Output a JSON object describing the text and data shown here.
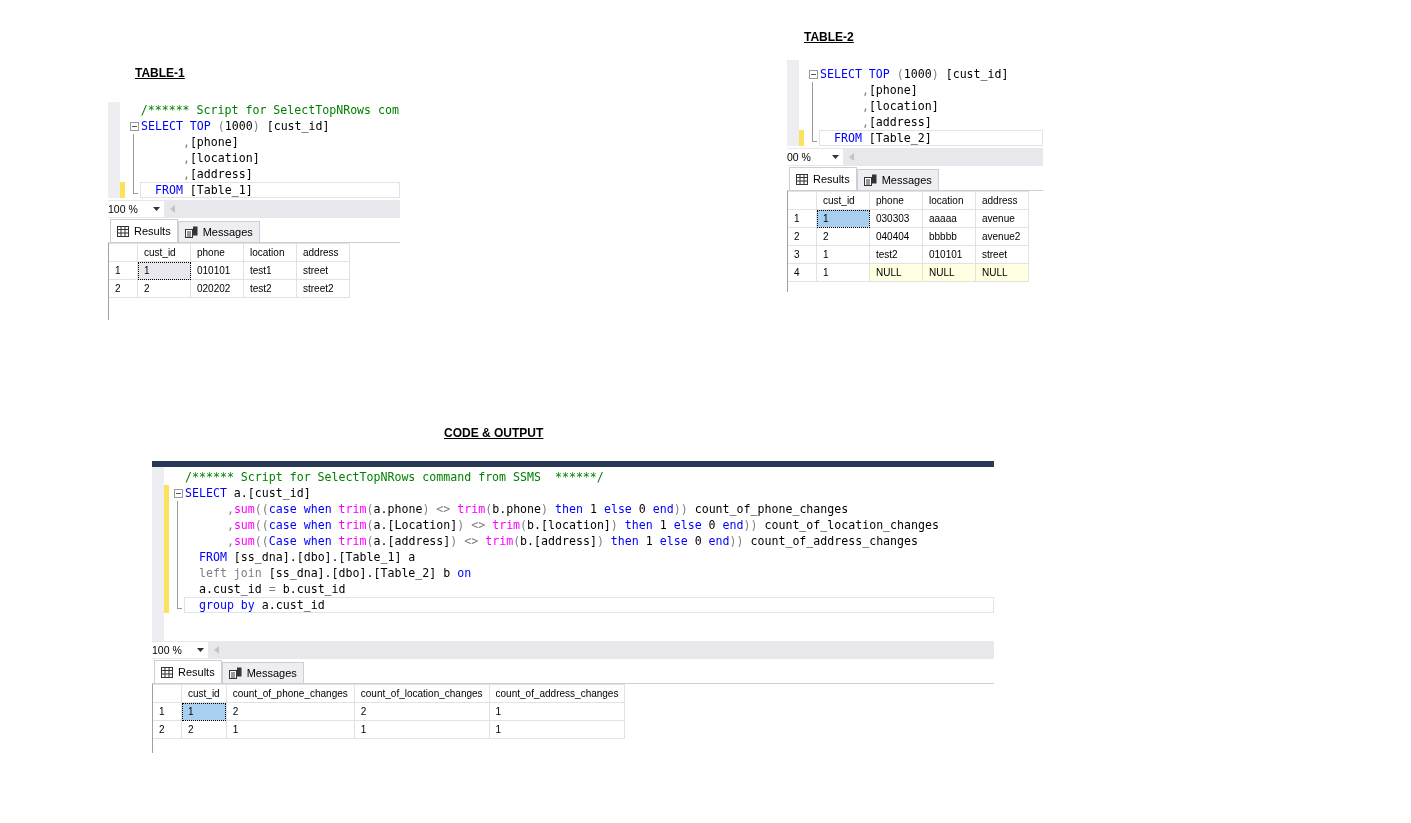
{
  "panels": [
    {
      "heading": "TABLE-1",
      "editor": {
        "tab_bar": false,
        "lines": [
          {
            "kind": "plain",
            "changed": false,
            "current": false,
            "tokens": [
              {
                "t": "/****** Script for SelectTopNRows com",
                "kind": "comment"
              }
            ]
          },
          {
            "kind": "fold_start",
            "changed": false,
            "current": false,
            "tokens": [
              {
                "t": "SELECT",
                "kind": "keyword"
              },
              {
                "t": " TOP",
                "kind": "keyword"
              },
              {
                "t": " (",
                "kind": "gray"
              },
              {
                "t": "1000",
                "kind": "plain"
              },
              {
                "t": ")",
                "kind": "gray"
              },
              {
                "t": " [cust_id]",
                "kind": "plain"
              }
            ]
          },
          {
            "kind": "fold_line",
            "changed": false,
            "current": false,
            "tokens": [
              {
                "t": "      ,",
                "kind": "gray"
              },
              {
                "t": "[phone]",
                "kind": "plain"
              }
            ]
          },
          {
            "kind": "fold_line",
            "changed": false,
            "current": false,
            "tokens": [
              {
                "t": "      ,",
                "kind": "gray"
              },
              {
                "t": "[location]",
                "kind": "plain"
              }
            ]
          },
          {
            "kind": "fold_line",
            "changed": false,
            "current": false,
            "tokens": [
              {
                "t": "      ,",
                "kind": "gray"
              },
              {
                "t": "[address]",
                "kind": "plain"
              }
            ]
          },
          {
            "kind": "fold_end",
            "changed": true,
            "current": true,
            "tokens": [
              {
                "t": "  FROM",
                "kind": "keyword"
              },
              {
                "t": " [Table_1]",
                "kind": "plain"
              }
            ]
          }
        ]
      },
      "zoom": "100 %",
      "tabs": [
        {
          "label": "Results",
          "selected": true
        },
        {
          "label": "Messages",
          "selected": false
        }
      ],
      "grid": {
        "focused": false,
        "columns": [
          "cust_id",
          "phone",
          "location",
          "address"
        ],
        "rows": [
          {
            "number": "1",
            "selected": true,
            "cells": [
              "1",
              "010101",
              "test1",
              "street"
            ]
          },
          {
            "number": "2",
            "selected": false,
            "cells": [
              "2",
              "020202",
              "test2",
              "street2"
            ]
          }
        ]
      }
    },
    {
      "heading": "TABLE-2",
      "editor": {
        "tab_bar": false,
        "lines": [
          {
            "kind": "fold_start",
            "changed": false,
            "current": false,
            "tokens": [
              {
                "t": "SELECT",
                "kind": "keyword"
              },
              {
                "t": " TOP",
                "kind": "keyword"
              },
              {
                "t": " (",
                "kind": "gray"
              },
              {
                "t": "1000",
                "kind": "plain"
              },
              {
                "t": ")",
                "kind": "gray"
              },
              {
                "t": " [cust_id]",
                "kind": "plain"
              }
            ]
          },
          {
            "kind": "fold_line",
            "changed": false,
            "current": false,
            "tokens": [
              {
                "t": "      ,",
                "kind": "gray"
              },
              {
                "t": "[phone]",
                "kind": "plain"
              }
            ]
          },
          {
            "kind": "fold_line",
            "changed": false,
            "current": false,
            "tokens": [
              {
                "t": "      ,",
                "kind": "gray"
              },
              {
                "t": "[location]",
                "kind": "plain"
              }
            ]
          },
          {
            "kind": "fold_line",
            "changed": false,
            "current": false,
            "tokens": [
              {
                "t": "      ,",
                "kind": "gray"
              },
              {
                "t": "[address]",
                "kind": "plain"
              }
            ]
          },
          {
            "kind": "fold_end",
            "changed": true,
            "current": true,
            "tokens": [
              {
                "t": "  FROM",
                "kind": "keyword"
              },
              {
                "t": " [Table_2]",
                "kind": "plain"
              }
            ]
          }
        ]
      },
      "zoom": "00 %",
      "tabs": [
        {
          "label": "Results",
          "selected": true
        },
        {
          "label": "Messages",
          "selected": false
        }
      ],
      "grid": {
        "focused": true,
        "columns": [
          "cust_id",
          "phone",
          "location",
          "address"
        ],
        "rows": [
          {
            "number": "1",
            "selected": true,
            "cells": [
              "1",
              "030303",
              "aaaaa",
              "avenue"
            ]
          },
          {
            "number": "2",
            "selected": false,
            "cells": [
              "2",
              "040404",
              "bbbbb",
              "avenue2"
            ]
          },
          {
            "number": "3",
            "selected": false,
            "cells": [
              "1",
              "test2",
              "010101",
              "street"
            ]
          },
          {
            "number": "4",
            "selected": false,
            "cells": [
              "1",
              {
                "text": "NULL",
                "kind": "null"
              },
              {
                "text": "NULL",
                "kind": "null"
              },
              {
                "text": "NULL",
                "kind": "null"
              }
            ]
          }
        ]
      }
    },
    {
      "heading": "CODE & OUTPUT",
      "editor": {
        "tab_bar": true,
        "lines": [
          {
            "kind": "plain",
            "changed": false,
            "current": false,
            "tokens": [
              {
                "t": "/****** Script for SelectTopNRows command from SSMS  ******/",
                "kind": "comment"
              }
            ]
          },
          {
            "kind": "fold_start",
            "changed": true,
            "current": false,
            "tokens": [
              {
                "t": "SELECT",
                "kind": "keyword"
              },
              {
                "t": " a.[cust_id]",
                "kind": "plain"
              }
            ]
          },
          {
            "kind": "fold_line",
            "changed": true,
            "current": false,
            "tokens": [
              {
                "t": "      ,",
                "kind": "gray"
              },
              {
                "t": "sum",
                "kind": "function"
              },
              {
                "t": "((",
                "kind": "gray"
              },
              {
                "t": "case",
                "kind": "keyword"
              },
              {
                "t": " when",
                "kind": "keyword"
              },
              {
                "t": " trim",
                "kind": "function"
              },
              {
                "t": "(",
                "kind": "gray"
              },
              {
                "t": "a.phone",
                "kind": "plain"
              },
              {
                "t": ") <>",
                "kind": "gray"
              },
              {
                "t": " trim",
                "kind": "function"
              },
              {
                "t": "(",
                "kind": "gray"
              },
              {
                "t": "b.phone",
                "kind": "plain"
              },
              {
                "t": ")",
                "kind": "gray"
              },
              {
                "t": " then",
                "kind": "keyword"
              },
              {
                "t": " 1",
                "kind": "plain"
              },
              {
                "t": " else",
                "kind": "keyword"
              },
              {
                "t": " 0",
                "kind": "plain"
              },
              {
                "t": " end",
                "kind": "keyword"
              },
              {
                "t": "))",
                "kind": "gray"
              },
              {
                "t": " count_of_phone_changes",
                "kind": "plain"
              }
            ]
          },
          {
            "kind": "fold_line",
            "changed": true,
            "current": false,
            "tokens": [
              {
                "t": "      ,",
                "kind": "gray"
              },
              {
                "t": "sum",
                "kind": "function"
              },
              {
                "t": "((",
                "kind": "gray"
              },
              {
                "t": "case",
                "kind": "keyword"
              },
              {
                "t": " when",
                "kind": "keyword"
              },
              {
                "t": " trim",
                "kind": "function"
              },
              {
                "t": "(",
                "kind": "gray"
              },
              {
                "t": "a.[Location]",
                "kind": "plain"
              },
              {
                "t": ") <>",
                "kind": "gray"
              },
              {
                "t": " trim",
                "kind": "function"
              },
              {
                "t": "(",
                "kind": "gray"
              },
              {
                "t": "b.[location]",
                "kind": "plain"
              },
              {
                "t": ")",
                "kind": "gray"
              },
              {
                "t": " then",
                "kind": "keyword"
              },
              {
                "t": " 1",
                "kind": "plain"
              },
              {
                "t": " else",
                "kind": "keyword"
              },
              {
                "t": " 0",
                "kind": "plain"
              },
              {
                "t": " end",
                "kind": "keyword"
              },
              {
                "t": "))",
                "kind": "gray"
              },
              {
                "t": " count_of_location_changes",
                "kind": "plain"
              }
            ]
          },
          {
            "kind": "fold_line",
            "changed": true,
            "current": false,
            "tokens": [
              {
                "t": "      ,",
                "kind": "gray"
              },
              {
                "t": "sum",
                "kind": "function"
              },
              {
                "t": "((",
                "kind": "gray"
              },
              {
                "t": "Case",
                "kind": "keyword"
              },
              {
                "t": " when",
                "kind": "keyword"
              },
              {
                "t": " trim",
                "kind": "function"
              },
              {
                "t": "(",
                "kind": "gray"
              },
              {
                "t": "a.[address]",
                "kind": "plain"
              },
              {
                "t": ") <>",
                "kind": "gray"
              },
              {
                "t": " trim",
                "kind": "function"
              },
              {
                "t": "(",
                "kind": "gray"
              },
              {
                "t": "b.[address]",
                "kind": "plain"
              },
              {
                "t": ")",
                "kind": "gray"
              },
              {
                "t": " then",
                "kind": "keyword"
              },
              {
                "t": " 1",
                "kind": "plain"
              },
              {
                "t": " else",
                "kind": "keyword"
              },
              {
                "t": " 0",
                "kind": "plain"
              },
              {
                "t": " end",
                "kind": "keyword"
              },
              {
                "t": "))",
                "kind": "gray"
              },
              {
                "t": " count_of_address_changes",
                "kind": "plain"
              }
            ]
          },
          {
            "kind": "fold_line",
            "changed": true,
            "current": false,
            "tokens": [
              {
                "t": "  FROM",
                "kind": "keyword"
              },
              {
                "t": " [ss_dna].[dbo].[Table_1] a",
                "kind": "plain"
              }
            ]
          },
          {
            "kind": "fold_line",
            "changed": true,
            "current": false,
            "tokens": [
              {
                "t": "  left join",
                "kind": "gray"
              },
              {
                "t": " [ss_dna].[dbo].[Table_2] b",
                "kind": "plain"
              },
              {
                "t": " on",
                "kind": "keyword"
              }
            ]
          },
          {
            "kind": "fold_line",
            "changed": true,
            "current": false,
            "tokens": [
              {
                "t": "  a.cust_id",
                "kind": "plain"
              },
              {
                "t": " =",
                "kind": "gray"
              },
              {
                "t": " b.cust_id",
                "kind": "plain"
              }
            ]
          },
          {
            "kind": "fold_end",
            "changed": true,
            "current": true,
            "tokens": [
              {
                "t": "  group by",
                "kind": "keyword"
              },
              {
                "t": " a.cust_id",
                "kind": "plain"
              }
            ]
          }
        ]
      },
      "zoom": "100 %",
      "tabs": [
        {
          "label": "Results",
          "selected": true
        },
        {
          "label": "Messages",
          "selected": false
        }
      ],
      "grid": {
        "focused": true,
        "columns": [
          "cust_id",
          "count_of_phone_changes",
          "count_of_location_changes",
          "count_of_address_changes"
        ],
        "rows": [
          {
            "number": "1",
            "selected": true,
            "cells": [
              "1",
              "2",
              "2",
              "1"
            ]
          },
          {
            "number": "2",
            "selected": false,
            "cells": [
              "2",
              "1",
              "1",
              "1"
            ]
          }
        ]
      }
    }
  ]
}
